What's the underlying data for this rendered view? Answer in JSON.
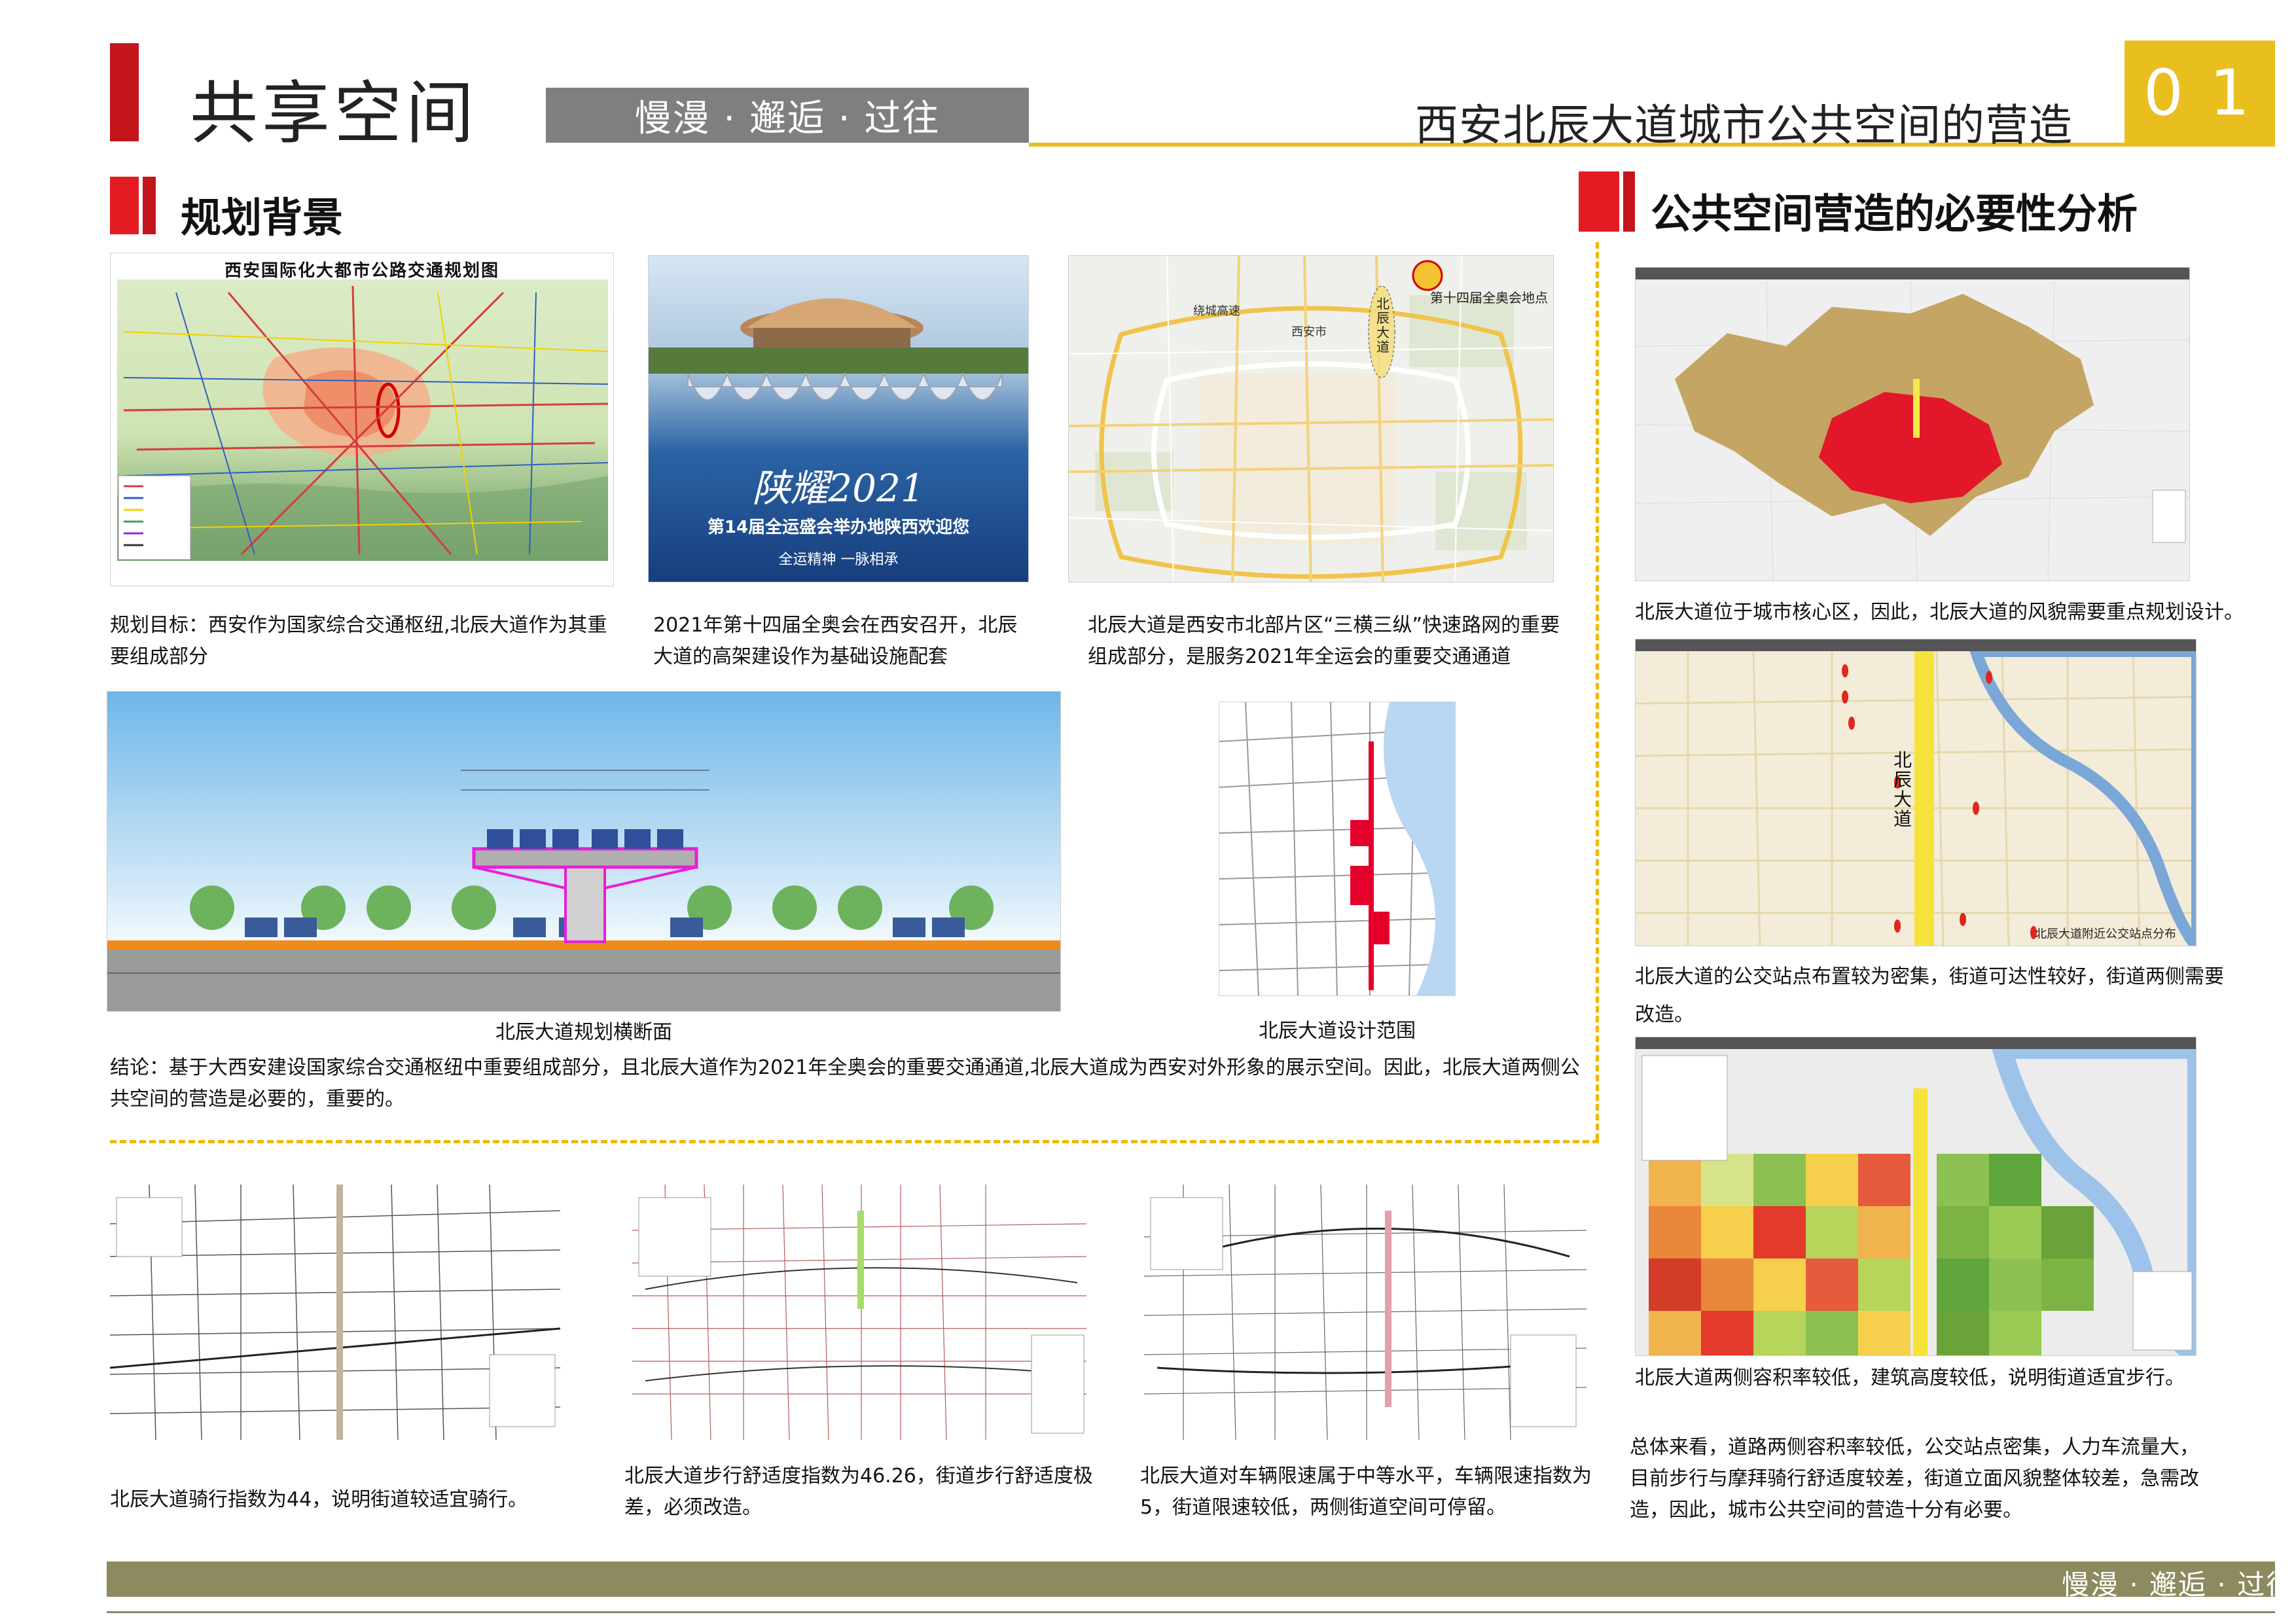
{
  "header": {
    "main_title": "共享空间",
    "subtitle": "慢漫 · 邂逅 · 过往",
    "project_title": "西安北辰大道城市公共空间的营造",
    "page_number": "01"
  },
  "section_left": {
    "title": "规划背景",
    "map1_title": "西安国际化大都市公路交通规划图",
    "caption1": "规划目标：西安作为国家综合交通枢纽,北辰大道作为其重要组成部分",
    "poster_title": "陕耀2021",
    "poster_line1": "第14届全运盛会举办地陕西欢迎您",
    "poster_line2": "全运精神 一脉相承",
    "caption2": "2021年第十四届全奥会在西安召开，北辰大道的高架建设作为基础设施配套",
    "map3_label_site": "第十四届全奥会地点",
    "map3_label_road": "北辰大道",
    "map3_label_city": "西安市",
    "map3_label_ring": "绕城高速",
    "caption3": "北辰大道是西安市北部片区“三横三纵”快速路网的重要组成部分，是服务2021年全运会的重要交通通道",
    "section_caption": "北辰大道规划横断面",
    "design_caption": "北辰大道设计范围",
    "conclusion": "结论：基于大西安建设国家综合交通枢纽中重要组成部分，且北辰大道作为2021年全奥会的重要交通通道,北辰大道成为西安对外形象的展示空间。因此，北辰大道两侧公共空间的营造是必要的，重要的。"
  },
  "bottom_maps": [
    {
      "caption": "北辰大道骑行指数为44，说明街道较适宜骑行。"
    },
    {
      "caption": "北辰大道步行舒适度指数为46.26，街道步行舒适度极差，必须改造。"
    },
    {
      "caption": "北辰大道对车辆限速属于中等水平，车辆限速指数为5，街道限速较低，两侧街道空间可停留。"
    }
  ],
  "section_right": {
    "title": "公共空间营造的必要性分析",
    "caption1": "北辰大道位于城市核心区，因此，北辰大道的风貌需要重点规划设计。",
    "map2_road_label": "北辰大道",
    "map2_legend": "北辰大道附近公交站点分布",
    "caption2": "北辰大道的公交站点布置较为密集，街道可达性较好，街道两侧需要改造。",
    "caption3": "北辰大道两侧容积率较低，建筑高度较低，说明街道适宜步行。",
    "summary": "总体来看，道路两侧容积率较低，公交站点密集，人力车流量大，目前步行与摩拜骑行舒适度较差，街道立面风貌整体较差，急需改造，因此，城市公共空间的营造十分有必要。"
  },
  "footer": {
    "text": "慢漫 · 邂逅 · 过往"
  },
  "colors": {
    "accent_red": "#c4151c",
    "accent_yellow": "#e9bf1f",
    "footer_olive": "#8c8a5e",
    "dash_orange": "#f0b800"
  }
}
